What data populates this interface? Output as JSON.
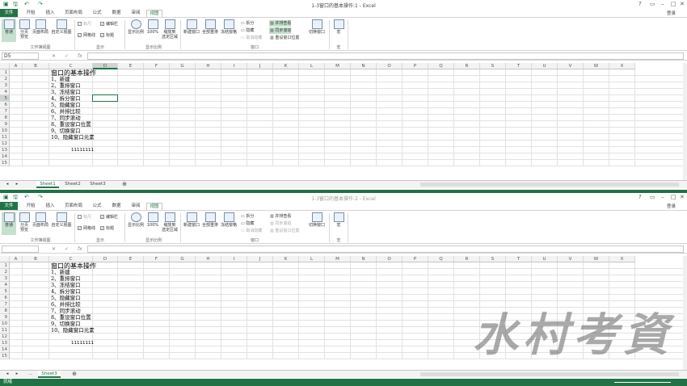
{
  "window1": {
    "title": "1-3窗口的基本操作:1 - Excel",
    "user": "登录",
    "tabs": [
      "文件",
      "开始",
      "插入",
      "页面布局",
      "公式",
      "数据",
      "审阅",
      "视图"
    ],
    "name_box": "D5",
    "sheet_tabs": [
      "Sheet1",
      "Sheet2",
      "Sheet3"
    ]
  },
  "window2": {
    "title": "1-3窗口的基本操作:2 - Excel",
    "user": "登录",
    "tabs": [
      "文件",
      "开始",
      "插入",
      "页面布局",
      "公式",
      "数据",
      "审阅",
      "视图"
    ],
    "name_box": "",
    "sheet_tabs": [
      "...",
      "Sheet3"
    ]
  },
  "ribbon": {
    "normal": "普通",
    "page_break": "分页\n预览",
    "page_layout": "页面布局",
    "custom_views": "自定义视图",
    "group_views": "工作簿视图",
    "ruler": "标尺",
    "formula_bar": "编辑栏",
    "gridlines": "网格线",
    "headings": "标题",
    "group_show": "显示",
    "zoom": "显示比例",
    "zoom100": "100%",
    "zoom_sel": "缩放到\n选定区域",
    "group_zoom": "显示比例",
    "new_window": "新建窗口",
    "arrange_all": "全部重排",
    "freeze": "冻结窗格",
    "split": "拆分",
    "hide": "隐藏",
    "unhide": "取消隐藏",
    "side_by_side": "并排查看",
    "sync_scroll": "同步滚动",
    "reset_pos": "重设窗口位置",
    "switch": "切换窗口",
    "group_window": "窗口",
    "macros": "宏",
    "group_macro": "宏"
  },
  "col_headers": [
    "A",
    "B",
    "C",
    "D",
    "E",
    "F",
    "G",
    "H",
    "I",
    "J",
    "K",
    "L",
    "M",
    "N",
    "O",
    "P",
    "Q",
    "R",
    "S",
    "T",
    "U",
    "V",
    "W",
    "X"
  ],
  "row_numbers": [
    "1",
    "2",
    "3",
    "4",
    "5",
    "6",
    "7",
    "8",
    "9",
    "10",
    "11",
    "12",
    "13",
    "14",
    "15"
  ],
  "cells": {
    "title": "窗口的基本操作",
    "items": [
      "1、新建",
      "2、重排窗口",
      "3、冻结窗口",
      "4、拆分窗口",
      "5、隐藏窗口",
      "6、并排比较",
      "7、同步滚动",
      "8、重设窗口位置",
      "9、切换窗口",
      "10、隐藏窗口元素"
    ],
    "number": "11111111"
  },
  "status": "就绪",
  "watermark": "水村考資"
}
